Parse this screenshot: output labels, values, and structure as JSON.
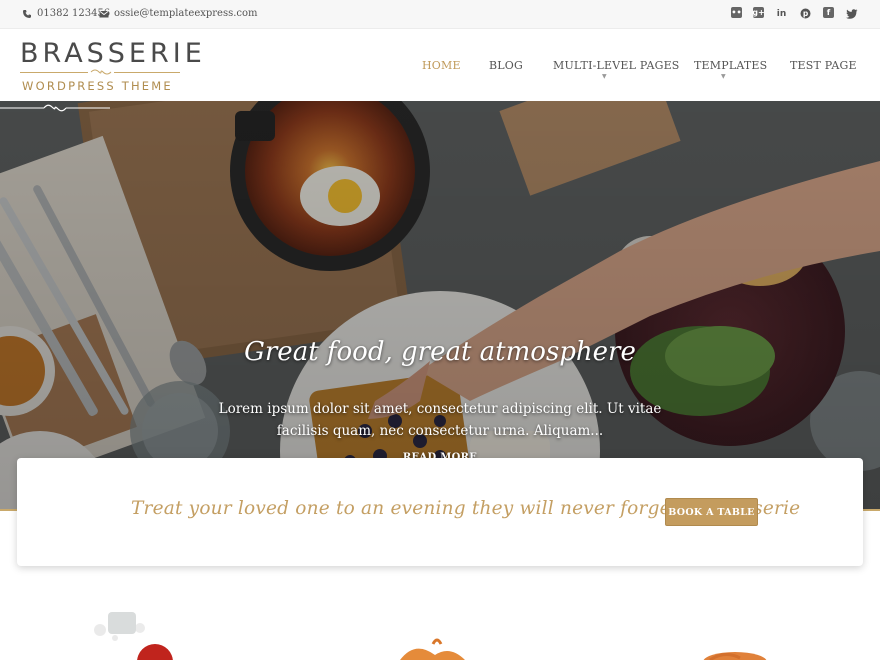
{
  "topbar": {
    "phone": "01382 123456",
    "email": "ossie@templateexpress.com",
    "social": [
      "flickr-icon",
      "google-plus-icon",
      "linkedin-icon",
      "pinterest-icon",
      "facebook-icon",
      "twitter-icon"
    ]
  },
  "header": {
    "logo_title": "BRASSERIE",
    "logo_subtitle": "WORDPRESS THEME",
    "nav": [
      {
        "label": "HOME",
        "active": true
      },
      {
        "label": "BLOG",
        "active": false
      },
      {
        "label": "MULTI-LEVEL PAGES",
        "active": false,
        "has_submenu": true
      },
      {
        "label": "TEMPLATES",
        "active": false,
        "has_submenu": true
      },
      {
        "label": "TEST PAGE",
        "active": false
      }
    ]
  },
  "hero": {
    "title": "Great food, great atmosphere",
    "text": "Lorem ipsum dolor sit amet, consectetur adipiscing elit. Ut vitae facilisis quam, nec consectetur urna. Aliquam...",
    "read_more": "READ MORE"
  },
  "cta": {
    "text": "Treat your loved one to an evening they will never forget at Brasserie",
    "button": "BOOK A TABLE"
  },
  "colors": {
    "accent": "#c49c5e",
    "nav_active": "#c09a5a",
    "text": "#555555"
  }
}
